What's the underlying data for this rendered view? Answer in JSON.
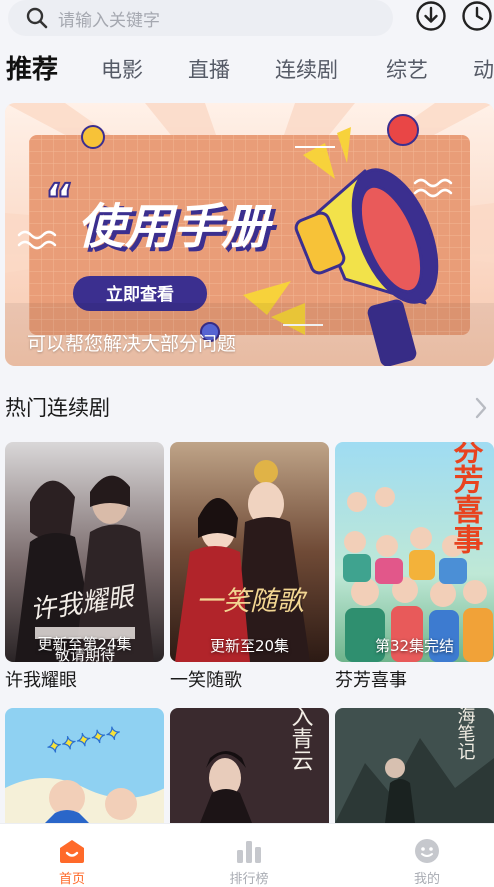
{
  "search": {
    "placeholder": "请输入关键字"
  },
  "header_icons": [
    "download-icon",
    "history-icon"
  ],
  "tabs": [
    "推荐",
    "电影",
    "直播",
    "连续剧",
    "综艺",
    "动"
  ],
  "banner": {
    "headline": "使用手册",
    "button": "立即查看",
    "caption": "可以帮您解决大部分问题"
  },
  "section": {
    "title": "热门连续剧"
  },
  "cards": [
    {
      "title": "许我耀眼",
      "badge": "更新至第24集",
      "poster_text": "许我耀眼",
      "poster_sub": "敬请期待"
    },
    {
      "title": "一笑随歌",
      "badge": "更新至20集",
      "poster_text": "一笑随歌"
    },
    {
      "title": "芬芳喜事",
      "badge": "第32集完结",
      "poster_text": "芬芳喜事"
    },
    {
      "title": "",
      "badge": "",
      "poster_text": ""
    },
    {
      "title": "",
      "badge": "",
      "poster_text": "入青云"
    },
    {
      "title": "",
      "badge": "",
      "poster_text": "藏海笔记"
    }
  ],
  "nav": [
    {
      "label": "首页",
      "icon": "home-icon",
      "active": true
    },
    {
      "label": "排行榜",
      "icon": "chart-icon",
      "active": false
    },
    {
      "label": "我的",
      "icon": "smile-icon",
      "active": false
    }
  ],
  "colors": {
    "accent": "#ff6a2a",
    "banner_bg": "#e9a07e",
    "banner_navy": "#3b2f8f"
  }
}
